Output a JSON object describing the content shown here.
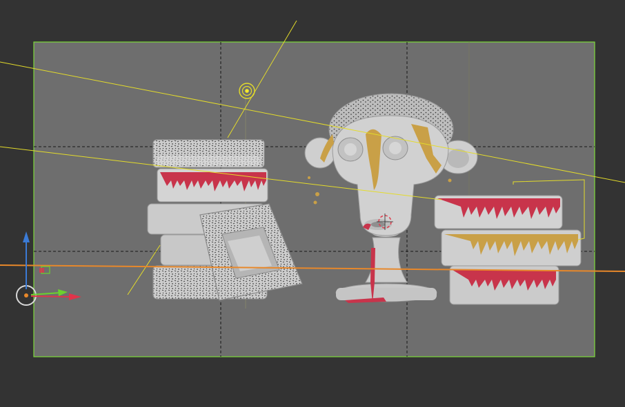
{
  "viewport": {
    "mode": "camera-view",
    "outside_color": "#353535",
    "camera_frame_color": "#6f6f6f",
    "frame_border_color": "#7ddc3a",
    "composition_guide_color": "#111111",
    "ground_line_color": "#e8882a",
    "light_line_color": "#e8e12a",
    "object_color": "#cfcfcf",
    "object_shadow": "#9a9a9a",
    "red_drip_color": "#c8344b",
    "yellow_drip_color": "#c9a047",
    "speckle_color": "#222222"
  },
  "gizmos": {
    "light_icon": "sun-light-icon",
    "origin_icon": "world-origin-icon",
    "cursor_icon": "3d-cursor-icon",
    "axis_x_color": "#e0344a",
    "axis_y_color": "#6bd12e",
    "axis_z_color": "#3b7bd6"
  },
  "objects": [
    "stack-left",
    "monkey-bust",
    "stack-right"
  ]
}
